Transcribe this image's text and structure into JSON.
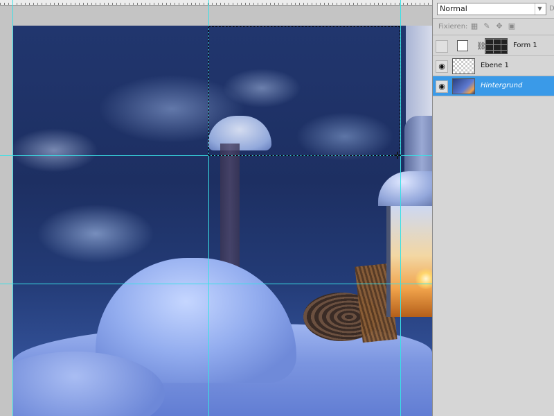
{
  "layers_panel": {
    "blend_mode": "Normal",
    "edge_label": "D",
    "lock_label": "Fixieren:",
    "lock_icons": [
      "lock-transparent-icon",
      "lock-paint-icon",
      "lock-move-icon",
      "lock-all-icon"
    ],
    "layers": [
      {
        "name": "Form 1",
        "visible": false,
        "selected": false,
        "thumb": "white",
        "mask": "grid"
      },
      {
        "name": "Ebene 1",
        "visible": true,
        "selected": false,
        "thumb": "transparent"
      },
      {
        "name": "Hintergrund",
        "visible": true,
        "selected": true,
        "thumb": "photo"
      }
    ]
  },
  "colors": {
    "guide": "#39e0e6",
    "selection_highlight": "#3a9ae8",
    "panel_background": "#d6d6d6"
  }
}
